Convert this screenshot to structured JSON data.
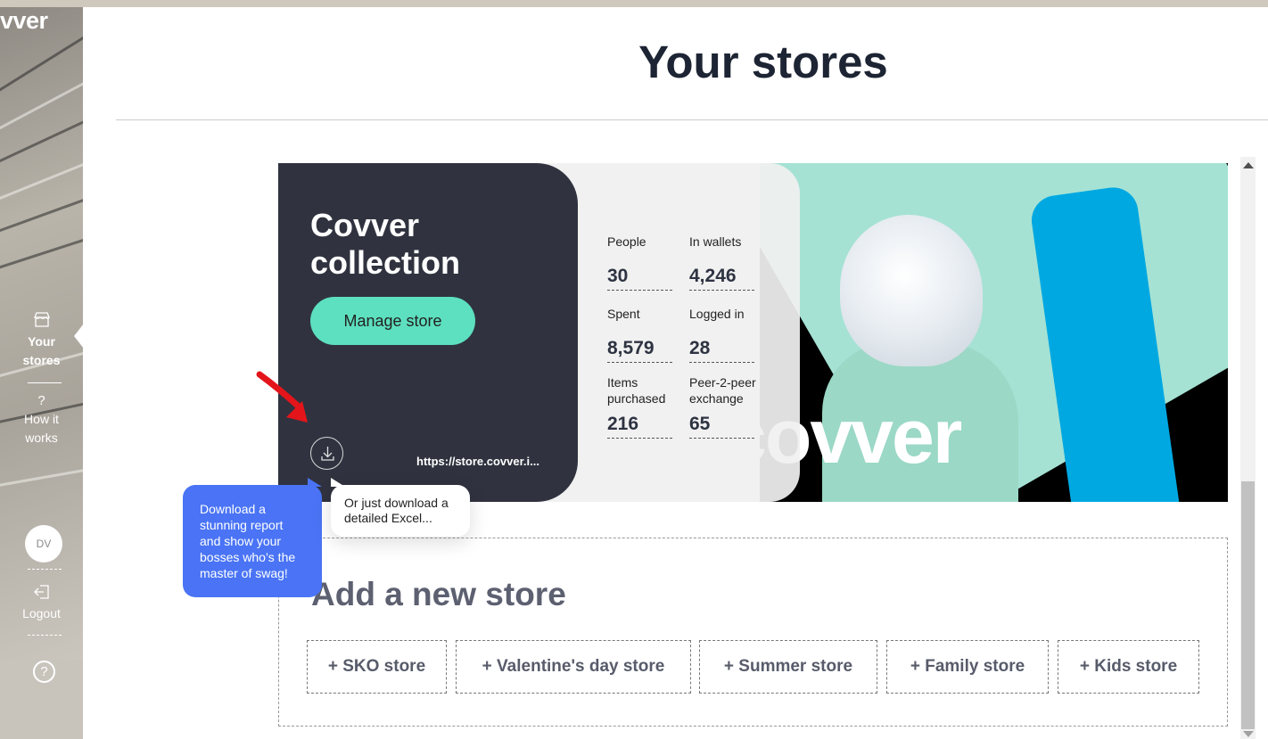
{
  "brand": {
    "logo_text": "vver"
  },
  "sidebar": {
    "items": [
      {
        "label_line1": "Your",
        "label_line2": "stores",
        "icon": "store-icon",
        "active": true
      },
      {
        "label_line1": "How it",
        "label_line2": "works",
        "icon": "question-icon",
        "active": false
      }
    ],
    "user": {
      "initials": "DV"
    },
    "logout_label": "Logout",
    "help_icon": "help-circle-icon"
  },
  "page": {
    "title": "Your stores"
  },
  "store": {
    "name_line1": "Covver",
    "name_line2": "collection",
    "manage_label": "Manage store",
    "url": "https://store.covver.i...",
    "download_icon": "download-icon",
    "watermark": "covver",
    "stats": [
      {
        "label_line1": "People",
        "label_line2": "",
        "value": "30"
      },
      {
        "label_line1": "In wallets",
        "label_line2": "",
        "value": "4,246"
      },
      {
        "label_line1": "Spent",
        "label_line2": "",
        "value": "8,579"
      },
      {
        "label_line1": "Logged in",
        "label_line2": "",
        "value": "28"
      },
      {
        "label_line1": "Items",
        "label_line2": "purchased",
        "value": "216"
      },
      {
        "label_line1": "Peer-2-peer",
        "label_line2": "exchange",
        "value": "65"
      }
    ]
  },
  "tooltips": {
    "report": "Download a stunning report and show your bosses who’s the master of swag!",
    "excel": "Or just download a detailed Excel..."
  },
  "add_store": {
    "title": "Add a new store",
    "options": [
      "+ SKO store",
      "+ Valentine's day store",
      "+ Summer store",
      "+ Family store",
      "+ Kids store"
    ]
  },
  "colors": {
    "dark_panel": "#30333f",
    "accent_mint": "#5de0bf",
    "tooltip_blue": "#4a74f5",
    "title_text": "#1d2433"
  }
}
